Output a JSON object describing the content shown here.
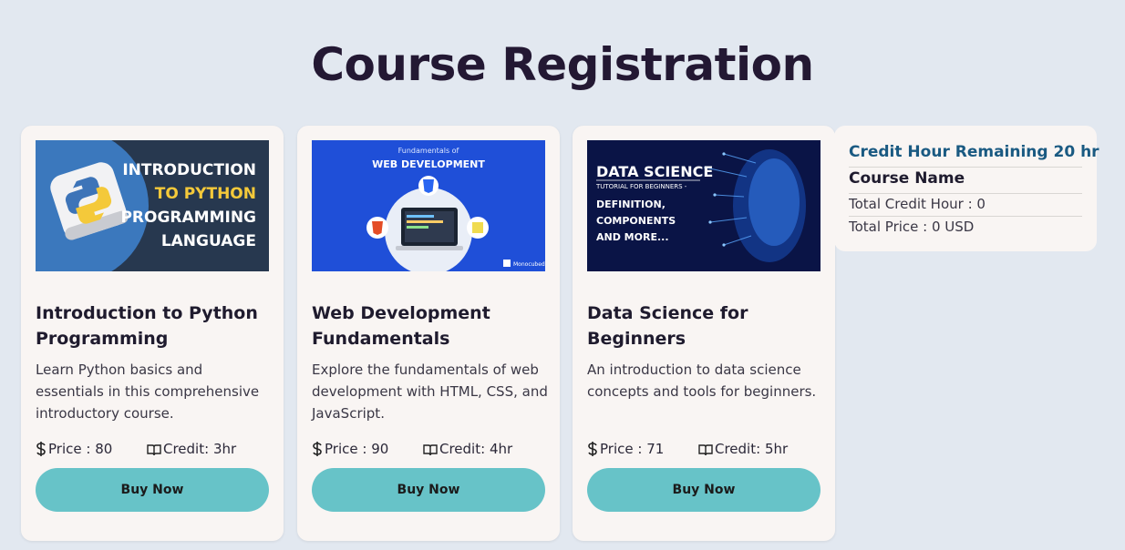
{
  "page": {
    "title": "Course Registration"
  },
  "labels": {
    "price_prefix": "Price : ",
    "credit_prefix": "Credit: ",
    "buy": "Buy Now"
  },
  "courses": [
    {
      "title": "Introduction to Python Programming",
      "description": "Learn Python basics and essentials in this comprehensive introductory course.",
      "price": "80",
      "credit": "3hr",
      "thumb": {
        "lines": [
          "INTRODUCTION",
          "TO PYTHON",
          "PROGRAMMING",
          "LANGUAGE"
        ]
      }
    },
    {
      "title": "Web Development Fundamentals",
      "description": "Explore the fundamentals of web development with HTML, CSS, and JavaScript.",
      "price": "90",
      "credit": "4hr",
      "thumb": {
        "small": "Fundamentals of",
        "big": "WEB DEVELOPMENT",
        "brand": "Monocubed"
      }
    },
    {
      "title": "Data Science for Beginners",
      "description": "An introduction to data science concepts and tools for beginners.",
      "price": "71",
      "credit": "5hr",
      "thumb": {
        "big": "DATA SCIENCE",
        "sub": "TUTORIAL FOR BEGINNERS -",
        "lines": [
          "DEFINITION,",
          "COMPONENTS",
          "AND MORE..."
        ]
      }
    }
  ],
  "summary": {
    "remaining": "Credit Hour Remaining 20 hr",
    "course_name": "Course Name",
    "total_credit": "Total Credit Hour : 0",
    "total_price": "Total Price : 0 USD"
  },
  "colors": {
    "background": "#e2e8f0",
    "card": "#f9f5f3",
    "button": "#67c3c8",
    "accent": "#1a5a82"
  },
  "icons": {
    "price": "dollar-icon",
    "credit": "book-icon"
  }
}
